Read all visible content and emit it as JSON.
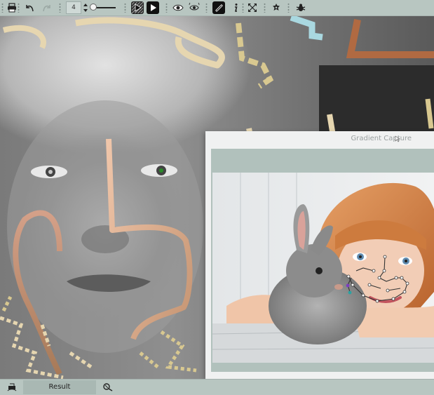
{
  "toolbar": {
    "brush_size": "4",
    "icons": [
      "print-icon",
      "undo-icon",
      "redo-icon",
      "play-pattern-icon",
      "play-icon",
      "eye-icon",
      "eye-rotate-icon",
      "eraser-icon",
      "info-icon",
      "expand-icon",
      "settings-icon",
      "bug-icon"
    ]
  },
  "capture_window": {
    "title": "Gradient Capture"
  },
  "statusbar": {
    "result_label": "Result"
  }
}
